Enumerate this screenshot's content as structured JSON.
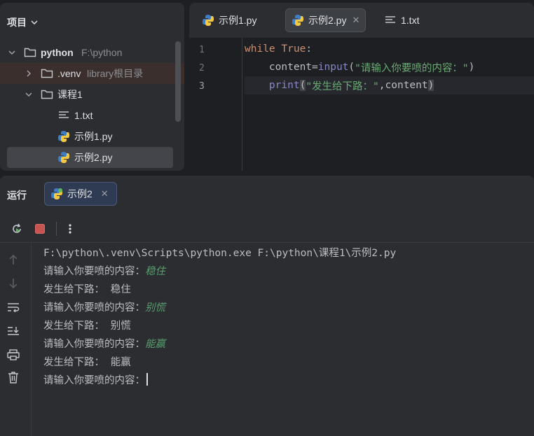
{
  "project": {
    "header": "项目",
    "root": {
      "name": "python",
      "path": "F:\\python"
    },
    "venv": {
      "name": ".venv",
      "note": "library根目录"
    },
    "folder": "课程1",
    "files": [
      "1.txt",
      "示例1.py",
      "示例2.py"
    ]
  },
  "editor": {
    "tabs": [
      {
        "label": "示例1.py",
        "icon": "python-icon"
      },
      {
        "label": "示例2.py",
        "icon": "python-icon",
        "active": true
      },
      {
        "label": "1.txt",
        "icon": "text-file-icon"
      }
    ],
    "line_numbers": [
      "1",
      "2",
      "3"
    ],
    "code": {
      "l1_kw": "while",
      "l1_cond": "True",
      "l1_colon": ":",
      "l2_indent": "    ",
      "l2_var": "content",
      "l2_eq": "=",
      "l2_fn": "input",
      "l2_open": "(",
      "l2_str": "\"请输入你要喷的内容：\"",
      "l2_close": ")",
      "l3_indent": "    ",
      "l3_fn": "print",
      "l3_open": "(",
      "l3_str": "\"发生给下路：\"",
      "l3_rest": ",content",
      "l3_close": ")"
    }
  },
  "run": {
    "title": "运行",
    "tab_label": "示例2",
    "console": {
      "command": "F:\\python\\.venv\\Scripts\\python.exe F:\\python\\课程1\\示例2.py",
      "prompt": "请输入你要喷的内容：",
      "output_prefix": "发生给下路： ",
      "inputs": [
        "稳住",
        "别慌",
        "能赢"
      ]
    }
  },
  "colors": {
    "accent": "#56a8f5",
    "string": "#6aab73",
    "keyword": "#cf8e6d",
    "stop": "#c75450"
  }
}
